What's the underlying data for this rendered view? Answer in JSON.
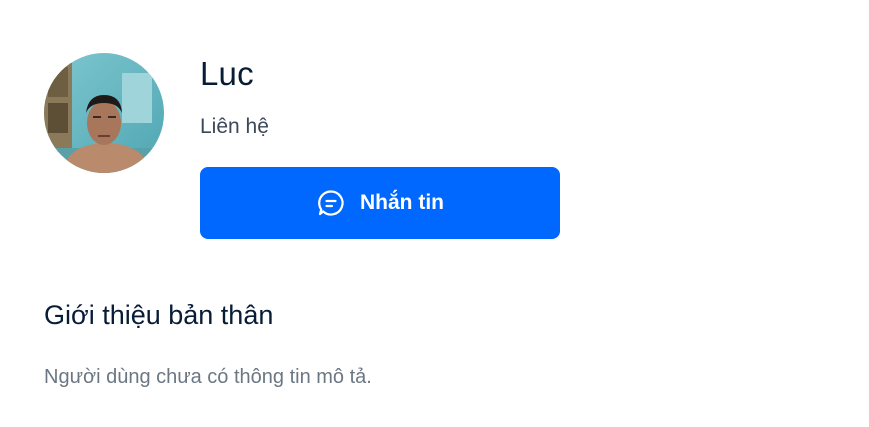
{
  "profile": {
    "name": "Luc",
    "relation": "Liên hệ",
    "avatar_alt": "avatar"
  },
  "actions": {
    "message_label": "Nhắn tin",
    "message_icon": "chat-bubble-icon",
    "accent_color": "#0068ff"
  },
  "about": {
    "title": "Giới thiệu bản thân",
    "text": "Người dùng chưa có thông tin mô tả."
  }
}
